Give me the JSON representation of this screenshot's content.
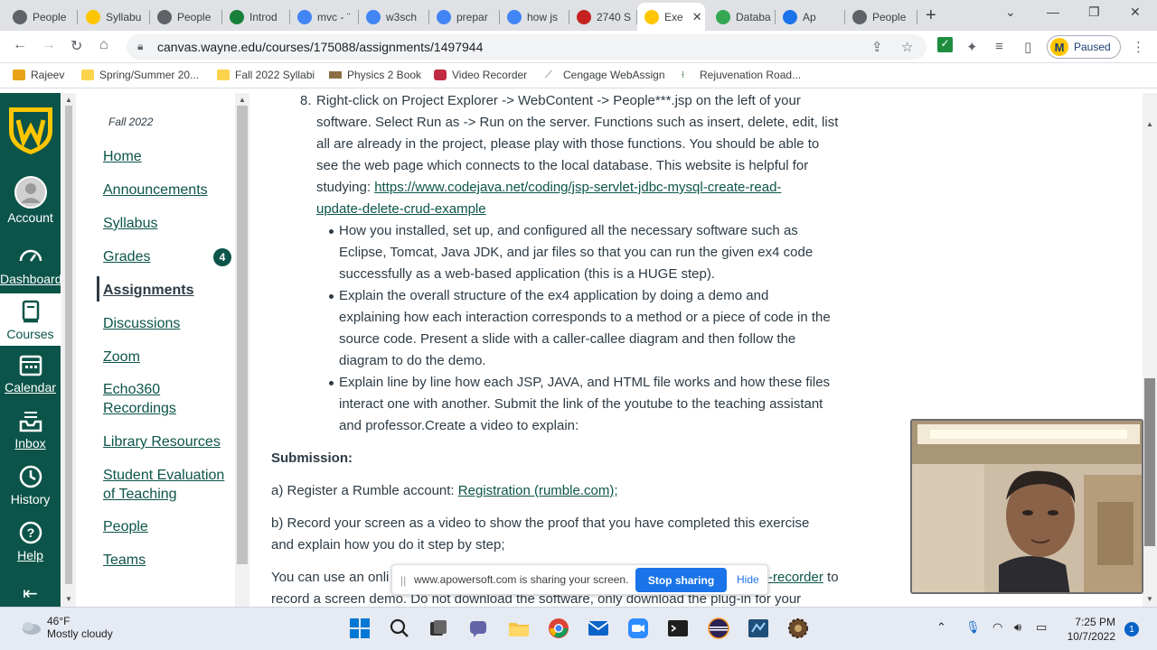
{
  "browser": {
    "tabs": [
      {
        "title": "People",
        "color": "#5f6368"
      },
      {
        "title": "Syllabu",
        "color": "#ffc600"
      },
      {
        "title": "People",
        "color": "#5f6368"
      },
      {
        "title": "Introd",
        "color": "#188038"
      },
      {
        "title": "mvc - ¨",
        "color": "#4285f4"
      },
      {
        "title": "w3sch",
        "color": "#4285f4"
      },
      {
        "title": "prepar",
        "color": "#4285f4"
      },
      {
        "title": "how js",
        "color": "#4285f4"
      },
      {
        "title": "2740 S",
        "color": "#c5221f"
      },
      {
        "title": "Exe",
        "color": "#ffc600"
      },
      {
        "title": "Databa",
        "color": "#34a853"
      },
      {
        "title": "Ap",
        "color": "#1a73e8"
      },
      {
        "title": "People",
        "color": "#5f6368"
      }
    ],
    "url": "canvas.wayne.edu/courses/175088/assignments/1497944",
    "profile_status": "Paused",
    "bookmarks": [
      "Rajeev",
      "Spring/Summer 20...",
      "Fall 2022 Syllabi",
      "Physics 2 Book",
      "Video Recorder",
      "Cengage WebAssign",
      "Rejuvenation Road..."
    ]
  },
  "global_nav": {
    "items": [
      "Account",
      "Dashboard",
      "Courses",
      "Calendar",
      "Inbox",
      "History",
      "Help"
    ]
  },
  "course_nav": {
    "term": "Fall 2022",
    "links": [
      "Home",
      "Announcements",
      "Syllabus",
      "Grades",
      "Assignments",
      "Discussions",
      "Zoom",
      "Echo360",
      "Recordings",
      "Library Resources",
      "Student Evaluation",
      "of Teaching",
      "People",
      "Teams"
    ],
    "grades_badge": "4"
  },
  "content": {
    "step8_num": "8.",
    "step8_lines": [
      "Right-click on Project Explorer -> WebContent -> People***.jsp on the left of your",
      "software. Select Run as -> Run on the server. Functions such as insert, delete, edit, list",
      "all are already in the project, please play with those functions. You should be able to",
      "see the web page which connects to the local database. This website is helpful for"
    ],
    "studying_prefix": "studying: ",
    "studying_link_1": "https://www.codejava.net/coding/jsp-servlet-jdbc-mysql-create-read-",
    "studying_link_2": "update-delete-crud-example",
    "bullets": [
      [
        "How you installed, set up, and configured all the necessary software such as",
        "Eclipse, Tomcat, Java JDK, and jar files so that you can run the given ex4 code",
        "successfully as a web-based application (this is a HUGE step)."
      ],
      [
        "Explain the overall structure of the ex4 application by doing a demo and",
        "explaining how each interaction corresponds to a method or a piece of code in the",
        "source code. Present a slide with a caller-callee diagram and then follow the",
        "diagram to do the demo."
      ],
      [
        "Explain line by line how each JSP, JAVA, and HTML file works and how these files",
        "interact one with another. Submit the link of the youtube to the teaching assistant",
        "and professor.Create a video to explain:"
      ]
    ],
    "submission_heading": "Submission:",
    "sub_a_prefix": "a) Register a Rumble account: ",
    "sub_a_link": "Registration (rumble.com);",
    "sub_b_1": "b) Record your screen as a video to show the proof that you have completed this exercise",
    "sub_b_2": "and explain how you do it step by step;",
    "sub_c_prefix": "You can use an onli",
    "sub_c_link": "-recorder",
    "sub_c_suffix": " to",
    "sub_c_2": "record a screen demo. Do not download the software, only download the plug-in for your"
  },
  "share_bar": {
    "message": "www.apowersoft.com is sharing your screen.",
    "stop_label": "Stop sharing",
    "hide_label": "Hide"
  },
  "taskbar": {
    "temp": "46°F",
    "condition": "Mostly cloudy",
    "time": "7:25 PM",
    "date": "10/7/2022",
    "notifications": "1"
  }
}
